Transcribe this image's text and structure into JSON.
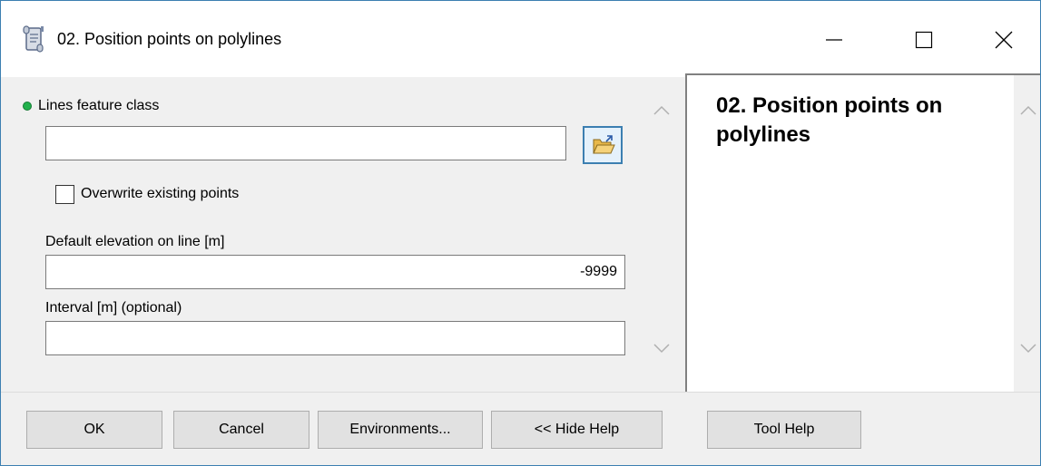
{
  "window": {
    "title": "02. Position points on polylines",
    "icon": "toolbox-script-icon",
    "controls": [
      "minimize-icon",
      "maximize-icon",
      "close-icon"
    ]
  },
  "form": {
    "lines_label": "Lines feature class",
    "lines_value": "",
    "overwrite_label": "Overwrite existing points",
    "overwrite_checked": false,
    "default_elevation_label": "Default elevation on line [m]",
    "default_elevation_value": "-9999",
    "interval_label": "Interval [m] (optional)",
    "interval_value": ""
  },
  "help": {
    "heading": "02. Position points on polylines"
  },
  "buttons": {
    "ok": "OK",
    "cancel": "Cancel",
    "environments": "Environments...",
    "hide_help": "<< Hide Help",
    "tool_help": "Tool Help"
  },
  "colors": {
    "required_dot": "#22b14c",
    "window_border": "#3c7fb1",
    "panel_bg": "#f0f0f0",
    "button_bg": "#e1e1e1"
  }
}
